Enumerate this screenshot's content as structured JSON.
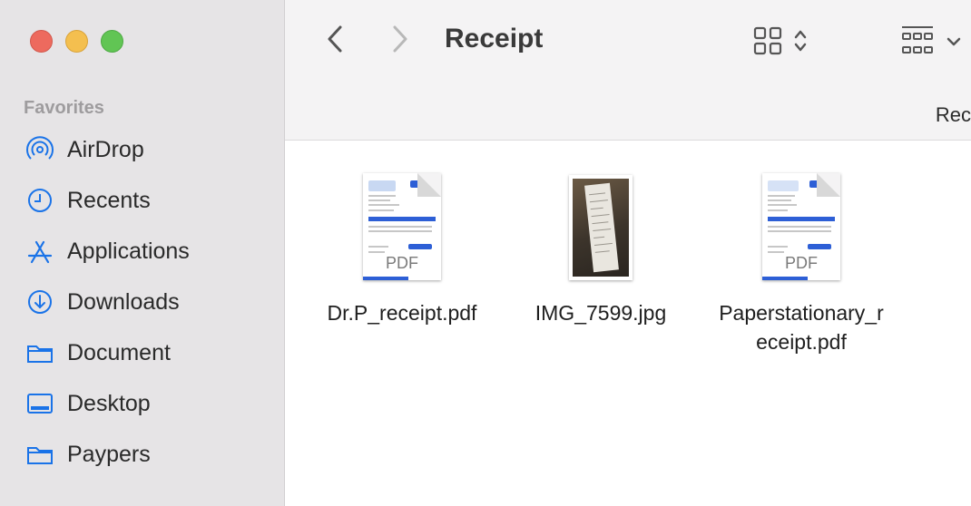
{
  "window": {
    "traffic_lights": [
      "close",
      "minimize",
      "zoom"
    ]
  },
  "sidebar": {
    "section_title": "Favorites",
    "items": [
      {
        "label": "AirDrop",
        "icon": "airdrop-icon"
      },
      {
        "label": "Recents",
        "icon": "clock-icon"
      },
      {
        "label": "Applications",
        "icon": "applications-icon"
      },
      {
        "label": "Downloads",
        "icon": "download-icon"
      },
      {
        "label": "Document",
        "icon": "folder-icon"
      },
      {
        "label": "Desktop",
        "icon": "desktop-icon"
      },
      {
        "label": "Paypers",
        "icon": "folder-icon"
      }
    ]
  },
  "toolbar": {
    "title": "Receipt",
    "column_header": "Rec"
  },
  "files": [
    {
      "name": "Dr.P_receipt.pdf",
      "kind": "pdf",
      "badge": "PDF"
    },
    {
      "name": "IMG_7599.jpg",
      "kind": "image"
    },
    {
      "name": "Paperstationary_r\neceipt.pdf",
      "kind": "pdf",
      "badge": "PDF"
    }
  ],
  "colors": {
    "accent": "#1a73e8",
    "sidebar_bg": "#e6e4e6",
    "toolbar_bg": "#f4f3f4"
  }
}
